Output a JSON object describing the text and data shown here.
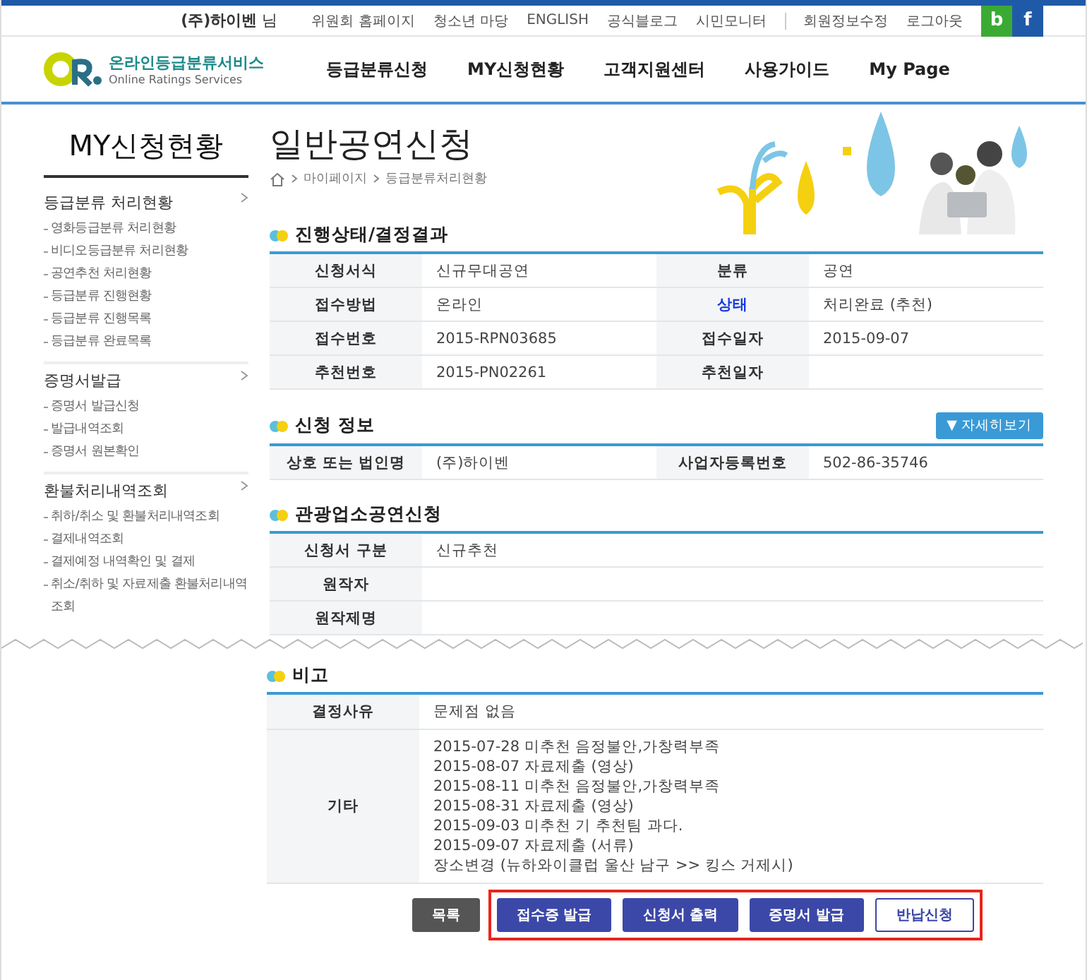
{
  "top_bar": {
    "user": "**(주)하이벤** 님",
    "links": [
      "위원회 홈페이지",
      "청소년 마당",
      "ENGLISH",
      "공식블로그",
      "시민모니터"
    ],
    "account_links": [
      "회원정보수정",
      "로그아웃"
    ],
    "social": [
      {
        "label": "b",
        "color": "#3aaa35"
      },
      {
        "label": "f",
        "color": "#1f5aa8"
      }
    ]
  },
  "header": {
    "logo": {
      "title": "온라인등급분류서비스",
      "subtitle": "Online Ratings Services"
    },
    "nav": [
      "등급분류신청",
      "MY신청현황",
      "고객지원센터",
      "사용가이드",
      "My Page"
    ]
  },
  "sidebar": {
    "title": "MY신청현황",
    "groups": [
      {
        "title": "등급분류 처리현황",
        "items": [
          "영화등급분류 처리현황",
          "비디오등급분류 처리현황",
          "공연추천 처리현황",
          "등급분류 진행현황",
          "등급분류 진행목록",
          "등급분류 완료목록"
        ]
      },
      {
        "title": "증명서발급",
        "items": [
          "증명서 발급신청",
          "발급내역조회",
          "증명서 원본확인"
        ]
      },
      {
        "title": "환불처리내역조회",
        "items": [
          "취하/취소 및 환불처리내역조회",
          "결제내역조회",
          "결제예정 내역확인 및 결제",
          "취소/취하 및 자료제출 환불처리내역조회"
        ]
      }
    ]
  },
  "page_title": "일반공연신청",
  "breadcrumb": [
    "마이페이지",
    "등급분류처리현황"
  ],
  "sections": [
    {
      "title": "진행상태/결정결과",
      "rows": [
        [
          {
            "label": "신청서식",
            "value": "신규무대공연",
            "emphasized": false
          },
          {
            "label": "분류",
            "value": "공연",
            "emphasized": false
          }
        ],
        [
          {
            "label": "접수방법",
            "value": "온라인",
            "emphasized": false
          },
          {
            "label": "상태",
            "value": "처리완료 (추천)",
            "emphasized": true
          }
        ],
        [
          {
            "label": "접수번호",
            "value": "2015-RPN03685",
            "emphasized": false
          },
          {
            "label": "접수일자",
            "value": "2015-09-07",
            "emphasized": false
          }
        ],
        [
          {
            "label": "추천번호",
            "value": "2015-PN02261",
            "emphasized": false
          },
          {
            "label": "추천일자",
            "emphasized": false
          }
        ]
      ]
    },
    {
      "title": "신청 정보",
      "action": "▼ 자세히보기",
      "rows": [
        [
          {
            "label": "상호 또는 법인명",
            "value": "(주)하이벤",
            "emphasized": false
          },
          {
            "label": "사업자등록번호",
            "value": "502-86-35746",
            "emphasized": false
          }
        ]
      ]
    },
    {
      "title": "관광업소공연신청",
      "rows": [
        [
          {
            "label": "신청서 구분",
            "value": "신규추천",
            "emphasized": false
          }
        ],
        [
          {
            "label": "원작자",
            "emphasized": false
          }
        ],
        [
          {
            "label": "원작제명",
            "emphasized": false
          }
        ]
      ]
    }
  ],
  "remarks": {
    "title": "비고",
    "rows": [
      {
        "label": "결정사유",
        "lines": [
          "문제점 없음"
        ]
      },
      {
        "label": "기타",
        "lines": [
          "2015-07-28 미추천 음정불안,가창력부족",
          "2015-08-07 자료제출 (영상)",
          "2015-08-11 미추천 음정불안,가창력부족",
          "2015-08-31 자료제출 (영상)",
          "2015-09-03 미추천 기 추천팀 과다.",
          "2015-09-07 자료제출 (서류)",
          "장소변경 (뉴하와이클럽 울산 남구 >> 킹스 거제시)"
        ]
      }
    ]
  },
  "buttons": [
    {
      "label": "목록",
      "kind": "dark"
    }
  ],
  "highlighted_buttons": [
    {
      "label": "접수증 발급",
      "kind": "primary"
    },
    {
      "label": "신청서 출력",
      "kind": "primary"
    },
    {
      "label": "증명서 발급",
      "kind": "primary"
    },
    {
      "label": "반납신청",
      "kind": "outline"
    }
  ]
}
